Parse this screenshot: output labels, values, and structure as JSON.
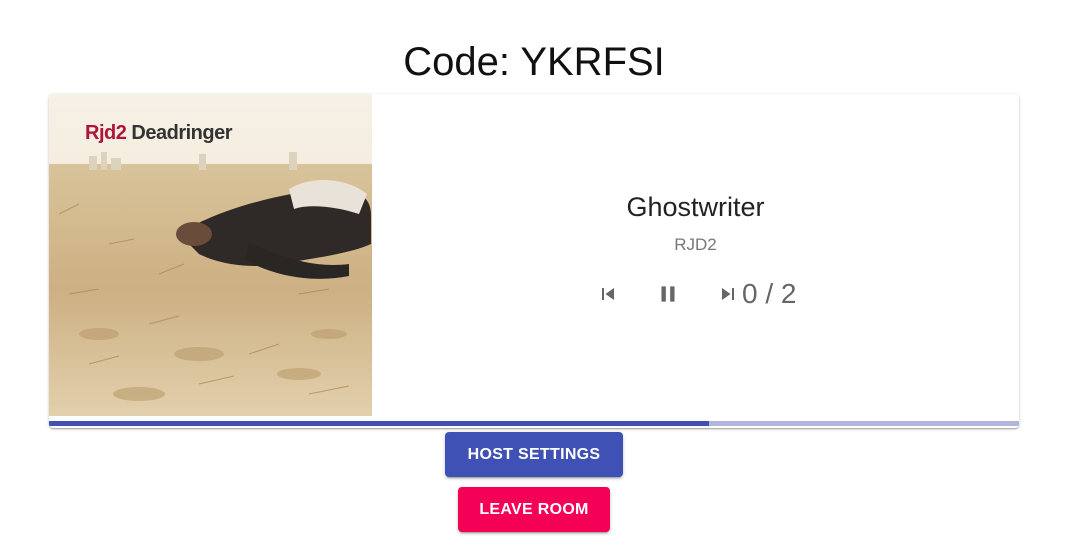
{
  "room": {
    "code_label": "Code: YKRFSI"
  },
  "album_art": {
    "artist_text": "Rjd2",
    "album_text": "Deadringer"
  },
  "now_playing": {
    "title": "Ghostwriter",
    "artist": "RJD2",
    "votes": "0 / 2",
    "progress_fraction": 0.68
  },
  "controls": {
    "previous_icon": "skip-previous-icon",
    "pause_icon": "pause-icon",
    "next_icon": "skip-next-icon"
  },
  "buttons": {
    "host_settings": "HOST SETTINGS",
    "leave_room": "LEAVE ROOM"
  },
  "colors": {
    "primary": "#3f51b5",
    "primary_light": "#b1b6dd",
    "secondary": "#f50057"
  }
}
